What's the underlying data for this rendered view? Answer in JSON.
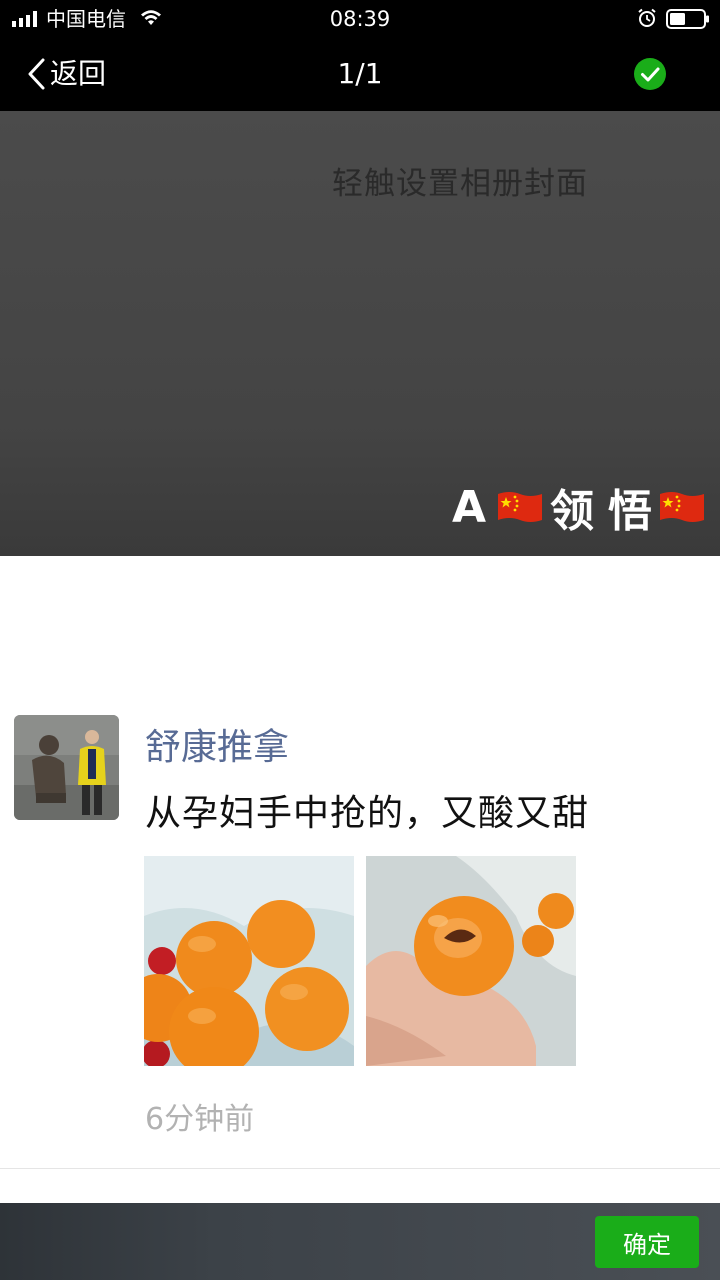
{
  "status_bar": {
    "carrier": "中国电信",
    "time": "08:39",
    "icons": [
      "signal-icon",
      "wifi-icon",
      "alarm-icon",
      "battery-icon"
    ]
  },
  "nav": {
    "back_label": "返回",
    "title": "1/1",
    "confirm_icon": "check-circle-icon",
    "accent": "#1aad19"
  },
  "cover": {
    "hint": "轻触设置相册封面",
    "name_prefix": "A",
    "name_part1": "领",
    "name_part2": "悟",
    "flag_icon": "china-flag-icon"
  },
  "post": {
    "username": "舒康推拿",
    "text": "从孕妇手中抢的，又酸又甜",
    "images": [
      "apricots-in-bag-photo",
      "bitten-apricot-in-hand-photo"
    ],
    "time": "6分钟前",
    "username_color": "#586b95"
  },
  "bottom_bar": {
    "confirm_label": "确定",
    "confirm_color": "#1aad19"
  }
}
